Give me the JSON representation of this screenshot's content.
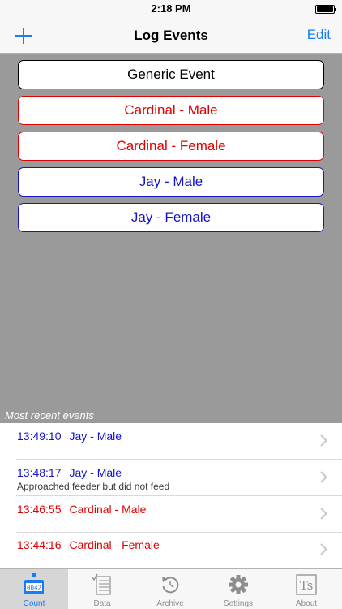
{
  "status_bar": {
    "time": "2:18 PM"
  },
  "nav": {
    "title": "Log Events",
    "edit_label": "Edit"
  },
  "colors": {
    "accent": "#1a7cf4",
    "red": "#e00000",
    "blue": "#1414c8",
    "black": "#000000"
  },
  "event_buttons": [
    {
      "label": "Generic Event",
      "color": "#000000"
    },
    {
      "label": "Cardinal - Male",
      "color": "#e00000"
    },
    {
      "label": "Cardinal - Female",
      "color": "#e00000"
    },
    {
      "label": "Jay - Male",
      "color": "#1414c8"
    },
    {
      "label": "Jay - Female",
      "color": "#1414c8"
    }
  ],
  "recent": {
    "label": "Most recent events",
    "items": [
      {
        "time": "13:49:10",
        "event": "Jay - Male",
        "note": "",
        "color": "#1414c8"
      },
      {
        "time": "13:48:17",
        "event": "Jay - Male",
        "note": "Approached feeder but did not feed",
        "color": "#1414c8"
      },
      {
        "time": "13:46:55",
        "event": "Cardinal - Male",
        "note": "",
        "color": "#e00000"
      },
      {
        "time": "13:44:16",
        "event": "Cardinal - Female",
        "note": "",
        "color": "#e00000"
      }
    ]
  },
  "tabs": [
    {
      "label": "Count",
      "icon": "counter-icon",
      "active": true,
      "counter_text": "0042"
    },
    {
      "label": "Data",
      "icon": "data-list-icon",
      "active": false
    },
    {
      "label": "Archive",
      "icon": "archive-icon",
      "active": false
    },
    {
      "label": "Settings",
      "icon": "gear-icon",
      "active": false
    },
    {
      "label": "About",
      "icon": "about-icon",
      "active": false,
      "icon_text": "Ts"
    }
  ]
}
